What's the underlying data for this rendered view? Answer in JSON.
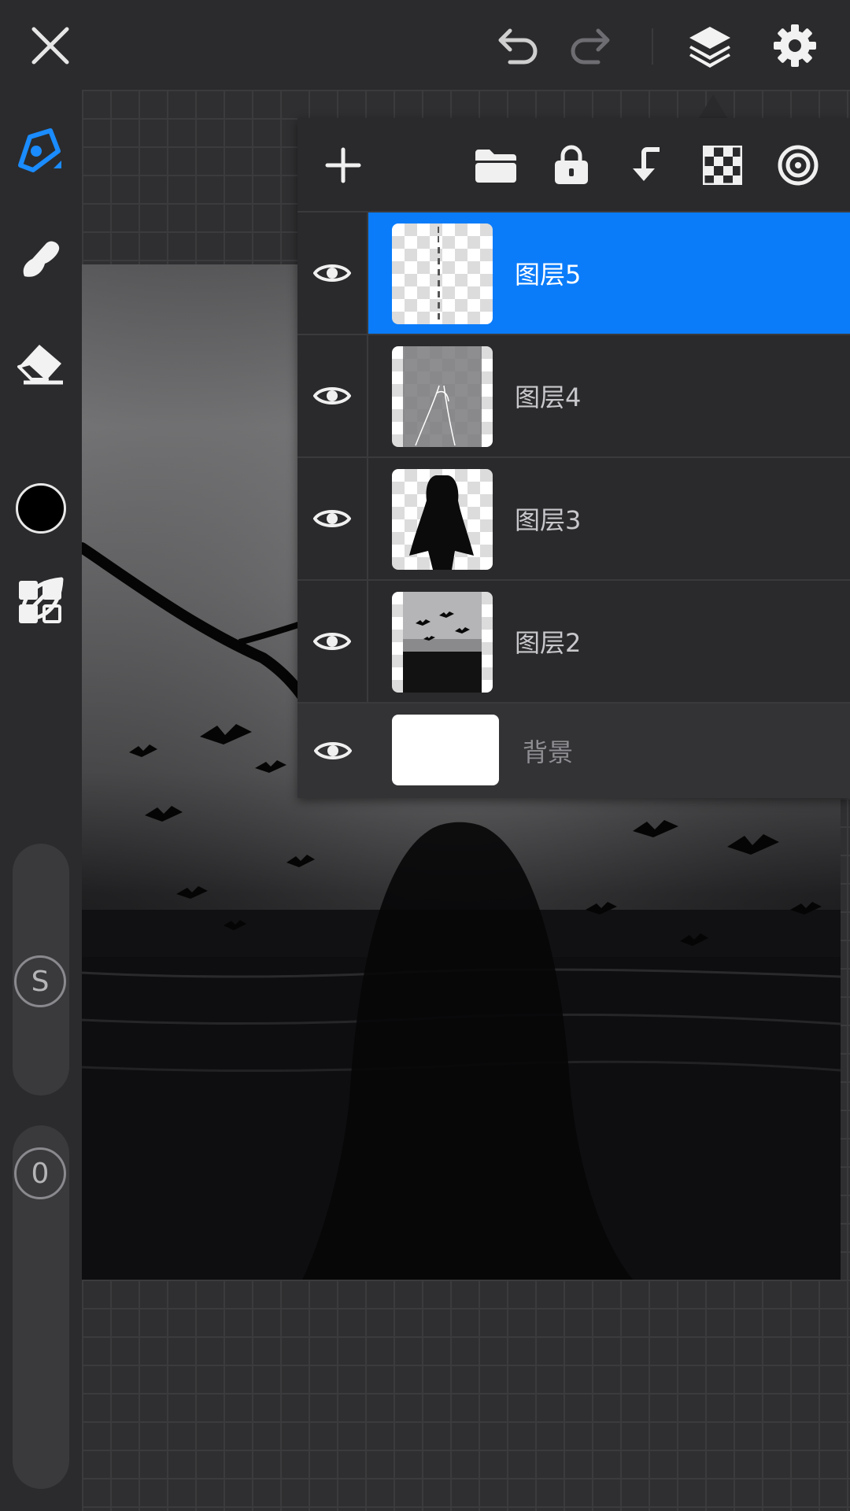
{
  "topbar": {
    "icons": [
      "close-icon",
      "undo-icon",
      "redo-icon",
      "layers-icon",
      "settings-icon"
    ]
  },
  "sidebar": {
    "tools": [
      "pen-tool-icon",
      "smudge-brush-icon",
      "eraser-icon",
      "color-swatch",
      "leaf-brush-icon",
      "grid-menu-icon"
    ],
    "current_color": "#000000",
    "size_slider_label": "S",
    "opacity_slider_label": "0"
  },
  "layers_panel": {
    "toolbar_icons": [
      "add-layer-icon",
      "folder-icon",
      "lock-icon",
      "merge-down-icon",
      "transparency-icon",
      "blend-mode-icon"
    ],
    "layers": [
      {
        "name": "图层5",
        "selected": true,
        "visible": true
      },
      {
        "name": "图层4",
        "selected": false,
        "visible": true
      },
      {
        "name": "图层3",
        "selected": false,
        "visible": true
      },
      {
        "name": "图层2",
        "selected": false,
        "visible": true
      }
    ],
    "background_layer": {
      "name": "背景",
      "visible": true
    },
    "accent_color": "#0a7cfa"
  }
}
